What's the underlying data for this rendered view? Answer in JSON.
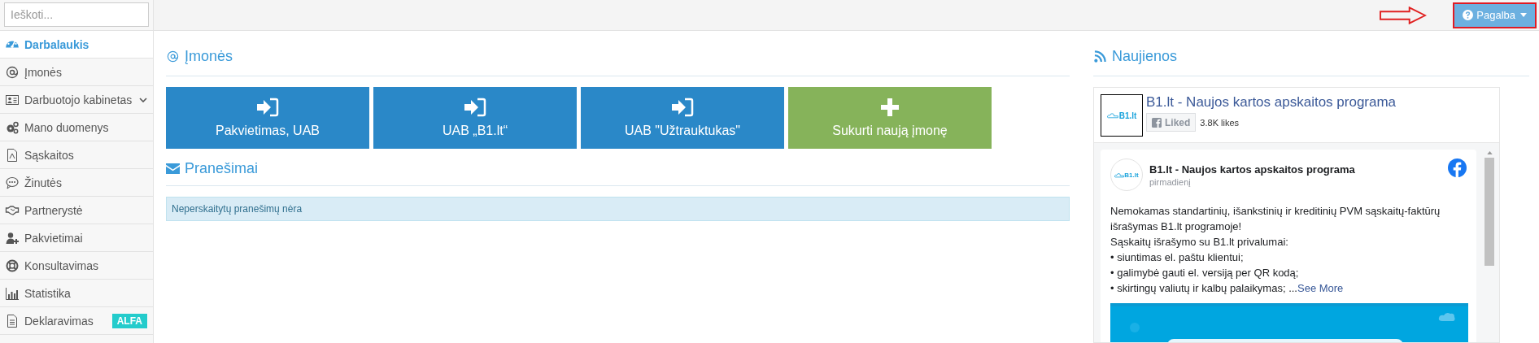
{
  "search": {
    "placeholder": "Ieškoti..."
  },
  "help_button": {
    "label": "Pagalba",
    "highlighted": true
  },
  "sidebar": {
    "items": [
      {
        "label": "Darbalaukis",
        "selected": true
      },
      {
        "label": "Įmonės",
        "selected": false
      },
      {
        "label": "Darbuotojo kabinetas",
        "selected": false,
        "expandable": true
      },
      {
        "label": "Mano duomenys",
        "selected": false
      },
      {
        "label": "Sąskaitos",
        "selected": false
      },
      {
        "label": "Žinutės",
        "selected": false
      },
      {
        "label": "Partnerystė",
        "selected": false
      },
      {
        "label": "Pakvietimai",
        "selected": false
      },
      {
        "label": "Konsultavimas",
        "selected": false
      },
      {
        "label": "Statistika",
        "selected": false
      },
      {
        "label": "Deklaravimas",
        "selected": false,
        "badge": "ALFA"
      }
    ]
  },
  "companies": {
    "title": "Įmonės",
    "buttons": [
      {
        "label": "Pakvietimas, UAB",
        "kind": "enter"
      },
      {
        "label": "UAB „B1.lt“",
        "kind": "enter"
      },
      {
        "label": "UAB \"Užtrauktukas\"",
        "kind": "enter"
      },
      {
        "label": "Sukurti naują įmonę",
        "kind": "create"
      }
    ]
  },
  "messages": {
    "title": "Pranešimai",
    "alert": "Neperskaitytų pranešimų nėra"
  },
  "news": {
    "title": "Naujienos",
    "widget": {
      "logo_text": "B1.lt",
      "page_name": "B1.lt - Naujos kartos apskaitos programa",
      "like_button": "Liked",
      "likes": "3.8K likes",
      "post": {
        "logo_text": "B1.lt",
        "author": "B1.lt - Naujos kartos apskaitos programa",
        "time": "pirmadienį",
        "paragraph": "Nemokamas standartinių, išankstinių ir kreditinių PVM sąskaitų-faktūrų išrašymas B1.lt programoje!",
        "lines": [
          "Sąskaitų išrašymo su B1.lt privalumai:",
          "• siuntimas el. paštu klientui;",
          "• galimybė gauti el. versiją per QR kodą;"
        ],
        "last_line": "• skirtingų valiutų ir kalbų palaikymas; ...",
        "see_more": "See More",
        "image": {
          "kind": "picture"
        }
      }
    }
  }
}
